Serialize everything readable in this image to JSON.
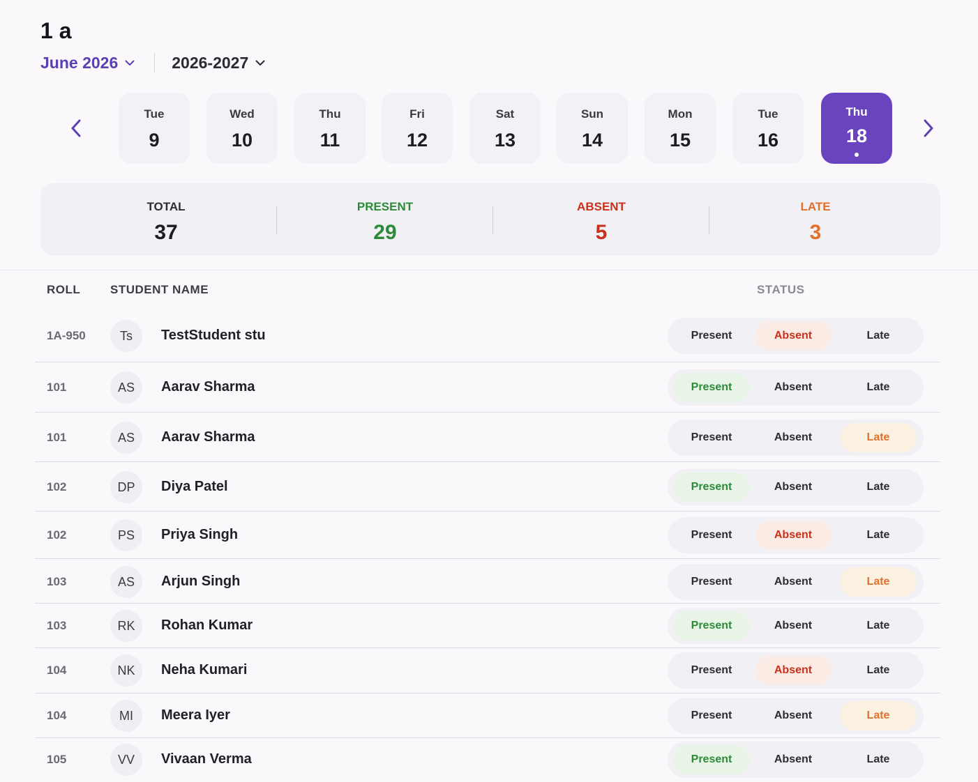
{
  "header": {
    "class_title": "1 a",
    "month_label": "June 2026",
    "year_label": "2026-2027"
  },
  "dates": [
    {
      "dow": "Tue",
      "day": "9",
      "selected": false
    },
    {
      "dow": "Wed",
      "day": "10",
      "selected": false
    },
    {
      "dow": "Thu",
      "day": "11",
      "selected": false
    },
    {
      "dow": "Fri",
      "day": "12",
      "selected": false
    },
    {
      "dow": "Sat",
      "day": "13",
      "selected": false
    },
    {
      "dow": "Sun",
      "day": "14",
      "selected": false
    },
    {
      "dow": "Mon",
      "day": "15",
      "selected": false
    },
    {
      "dow": "Tue",
      "day": "16",
      "selected": false
    },
    {
      "dow": "Thu",
      "day": "18",
      "selected": true
    }
  ],
  "summary": {
    "total_label": "TOTAL",
    "total": "37",
    "present_label": "PRESENT",
    "present": "29",
    "absent_label": "ABSENT",
    "absent": "5",
    "late_label": "LATE",
    "late": "3"
  },
  "colors": {
    "accent": "#6a44bf",
    "present": "#2e8a3a",
    "absent": "#c8321c",
    "late": "#e0702a"
  },
  "table": {
    "col_roll": "ROLL",
    "col_name": "STUDENT NAME",
    "col_status": "STATUS",
    "status_options": [
      "Present",
      "Absent",
      "Late"
    ],
    "rows": [
      {
        "roll": "1A-950",
        "initials": "Ts",
        "name": "TestStudent stu",
        "status": "Absent"
      },
      {
        "roll": "101",
        "initials": "AS",
        "name": "Aarav Sharma",
        "status": "Present"
      },
      {
        "roll": "101",
        "initials": "AS",
        "name": "Aarav Sharma",
        "status": "Late"
      },
      {
        "roll": "102",
        "initials": "DP",
        "name": "Diya Patel",
        "status": "Present"
      },
      {
        "roll": "102",
        "initials": "PS",
        "name": "Priya Singh",
        "status": "Absent"
      },
      {
        "roll": "103",
        "initials": "AS",
        "name": "Arjun Singh",
        "status": "Late"
      },
      {
        "roll": "103",
        "initials": "RK",
        "name": "Rohan Kumar",
        "status": "Present"
      },
      {
        "roll": "104",
        "initials": "NK",
        "name": "Neha Kumari",
        "status": "Absent"
      },
      {
        "roll": "104",
        "initials": "MI",
        "name": "Meera Iyer",
        "status": "Late"
      },
      {
        "roll": "105",
        "initials": "VV",
        "name": "Vivaan Verma",
        "status": "Present"
      }
    ]
  }
}
